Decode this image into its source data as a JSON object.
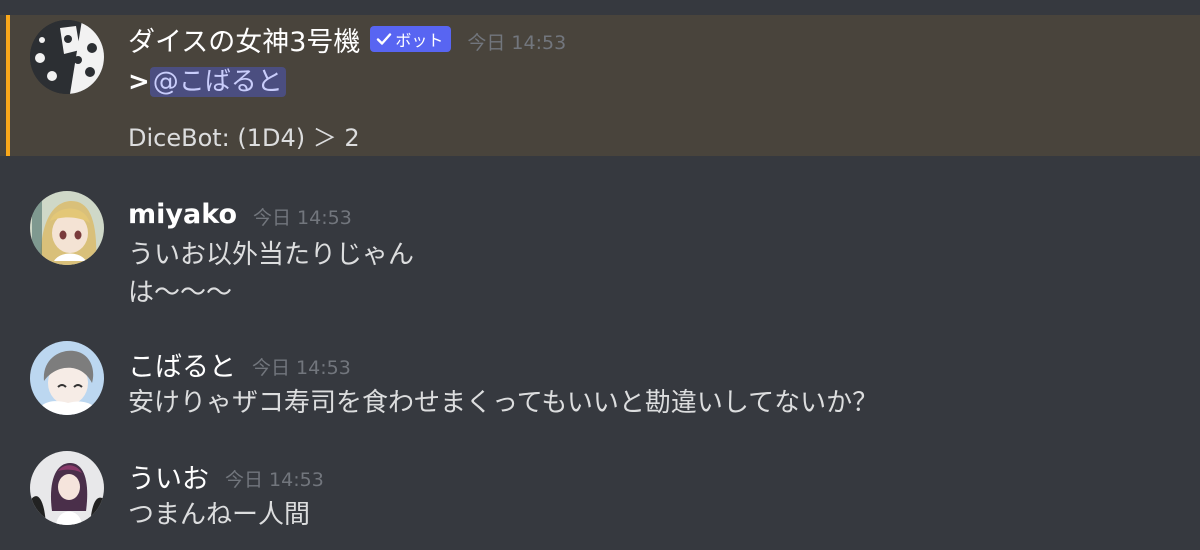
{
  "messages": [
    {
      "author": "ダイスの女神3号機",
      "bot_tag": "ボット",
      "timestamp": "今日 14:53",
      "reply_prefix": ">",
      "mention": "@こばると",
      "result": "DiceBot: (1D4) ＞ 2",
      "highlight_color": "#faa81a"
    },
    {
      "author": "miyako",
      "timestamp": "今日 14:53",
      "lines": [
        "ういお以外当たりじゃん",
        "は〜〜〜"
      ]
    },
    {
      "author": "こばると",
      "timestamp": "今日 14:53",
      "lines": [
        "安けりゃザコ寿司を食わせまくってもいいと勘違いしてないか？"
      ]
    },
    {
      "author": "ういお",
      "timestamp": "今日 14:53",
      "lines": [
        "つまんねー人間"
      ]
    }
  ],
  "colors": {
    "background": "#36393f",
    "highlight_background": "#49443c",
    "bot_tag": "#5865f2",
    "mention_background": "#4b4e80",
    "timestamp": "#72767d"
  }
}
